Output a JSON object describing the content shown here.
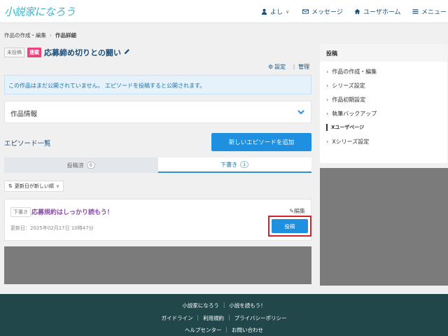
{
  "header": {
    "logo": "小説家になろう",
    "user_label": "よし",
    "messages_label": "メッセージ",
    "home_label": "ユーザホーム",
    "menu_label": "メニュー"
  },
  "breadcrumb": {
    "items": [
      "作品の作成・編集",
      "作品詳細"
    ],
    "separator": "›"
  },
  "work": {
    "status_tag": "未投稿",
    "type_tag": "連載",
    "title": "応募締め切りとの闘い",
    "settings_label": "設定",
    "manage_label": "管理"
  },
  "notice": "この作品はまだ公開されていません。 エピソードを投稿すると公開されます。",
  "info_panel": {
    "label": "作品情報"
  },
  "episodes": {
    "heading": "エピソード一覧",
    "new_button": "新しいエピソードを追加",
    "tabs": [
      {
        "label": "投稿済",
        "count": "0"
      },
      {
        "label": "下書き",
        "count": "1"
      }
    ],
    "sort_label": "更新日が新しい順",
    "items": [
      {
        "tag": "下書き",
        "title": "応募規約はしっかり読もう！",
        "edit_label": "編集",
        "updated": "更新日：2025年02月17日 10時47分",
        "post_label": "投稿"
      }
    ]
  },
  "sidebar": {
    "heading": "投稿",
    "items": [
      "作品の作成・編集",
      "シリーズ設定",
      "作品初期設定",
      "執筆バックアップ"
    ],
    "subheading": "Xユーザページ",
    "sub_items": [
      "Xシリーズ設定"
    ]
  },
  "footer": {
    "row1": [
      "小説家になろう",
      "小説を読もう！"
    ],
    "row2": [
      "ガイドライン",
      "利用規約",
      "プライバシーポリシー"
    ],
    "row3": [
      "ヘルプセンター",
      "お問い合わせ"
    ],
    "separator": "|"
  },
  "colors": {
    "accent": "#1f8fe0",
    "brand": "#3eb5c9",
    "serial_tag": "#e8457f",
    "highlight_border": "#d3222a",
    "footer_bg": "#21474b"
  }
}
